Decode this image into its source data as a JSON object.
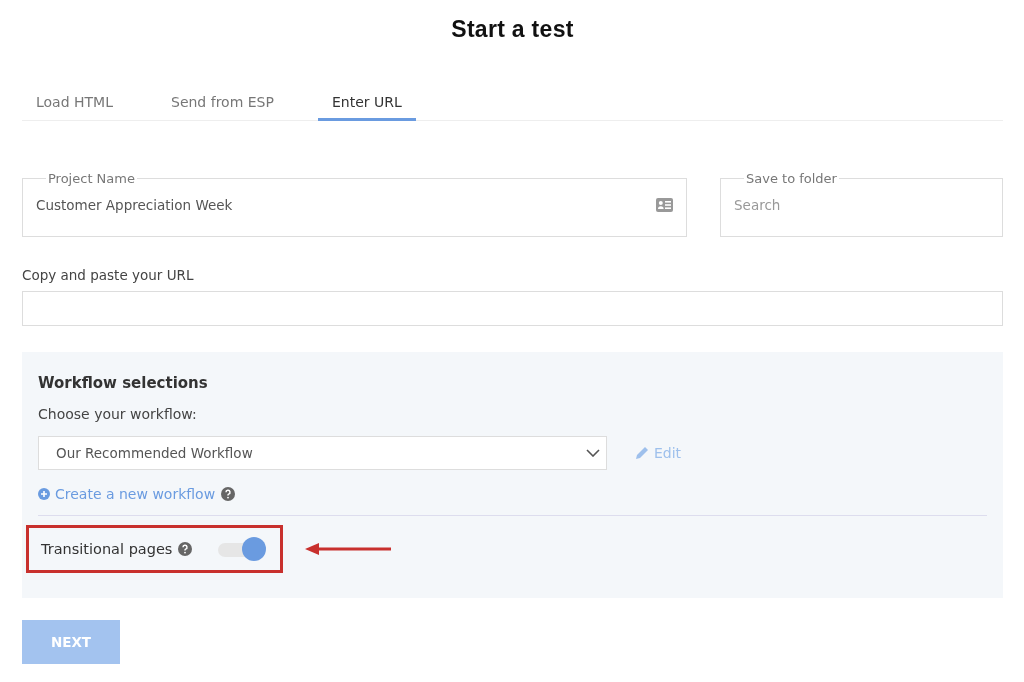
{
  "title": "Start a test",
  "tabs": [
    {
      "label": "Load HTML",
      "selected": false
    },
    {
      "label": "Send from ESP",
      "selected": false
    },
    {
      "label": "Enter URL",
      "selected": true
    }
  ],
  "project_name": {
    "label": "Project Name",
    "value": "Customer Appreciation Week"
  },
  "save_to_folder": {
    "label": "Save to folder",
    "placeholder": "Search"
  },
  "url": {
    "label": "Copy and paste your URL"
  },
  "workflow": {
    "heading": "Workflow selections",
    "prompt": "Choose your workflow:",
    "selected_workflow": "Our Recommended Workflow",
    "edit_link": "Edit",
    "create_link": "Create a new workflow"
  },
  "transitional_pages": {
    "label": "Transitional pages",
    "on": true
  },
  "next_button": {
    "label": "NEXT",
    "disabled": true
  }
}
